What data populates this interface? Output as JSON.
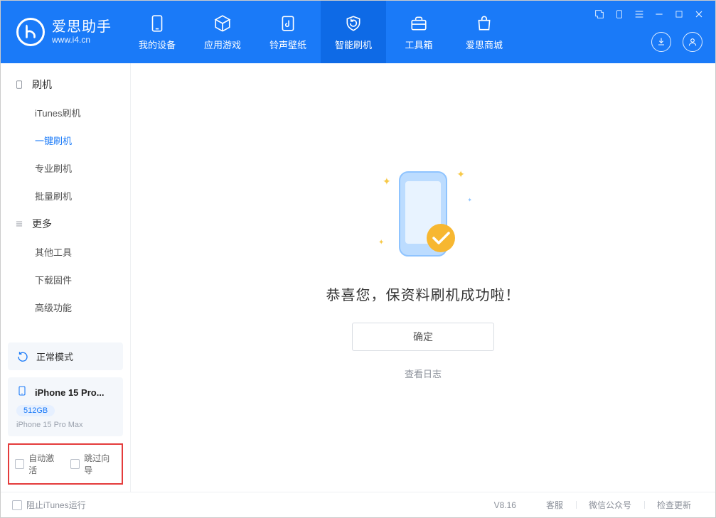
{
  "app": {
    "name": "爱思助手",
    "url": "www.i4.cn"
  },
  "nav": {
    "tabs": [
      {
        "label": "我的设备"
      },
      {
        "label": "应用游戏"
      },
      {
        "label": "铃声壁纸"
      },
      {
        "label": "智能刷机"
      },
      {
        "label": "工具箱"
      },
      {
        "label": "爱思商城"
      }
    ]
  },
  "sidebar": {
    "sections": [
      {
        "title": "刷机",
        "items": [
          "iTunes刷机",
          "一键刷机",
          "专业刷机",
          "批量刷机"
        ]
      },
      {
        "title": "更多",
        "items": [
          "其他工具",
          "下载固件",
          "高级功能"
        ]
      }
    ],
    "mode_label": "正常模式",
    "device": {
      "name": "iPhone 15 Pro...",
      "storage": "512GB",
      "model": "iPhone 15 Pro Max"
    },
    "checks": {
      "auto_activate": "自动激活",
      "skip_wizard": "跳过向导"
    }
  },
  "main": {
    "message": "恭喜您，保资料刷机成功啦！",
    "ok_label": "确定",
    "view_log": "查看日志"
  },
  "footer": {
    "block_itunes": "阻止iTunes运行",
    "version": "V8.16",
    "links": [
      "客服",
      "微信公众号",
      "检查更新"
    ]
  }
}
